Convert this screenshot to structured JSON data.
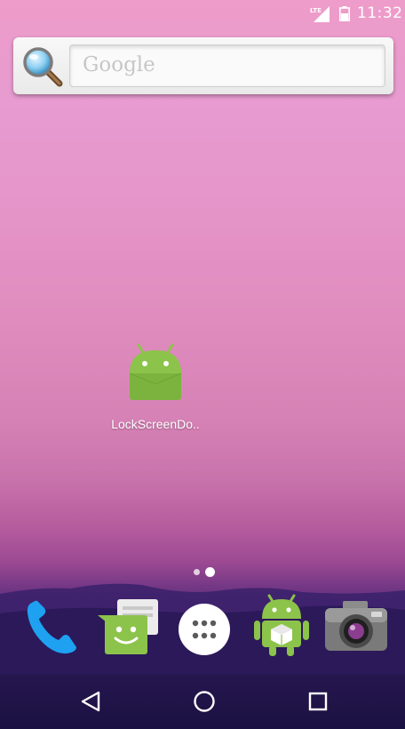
{
  "status_bar": {
    "network_label": "LTE",
    "time": "11:32",
    "icons": [
      "lte-signal-icon",
      "battery-icon"
    ]
  },
  "search_widget": {
    "placeholder": "Google",
    "icon": "magnifier-search-icon"
  },
  "home": {
    "shortcut": {
      "label": "LockScreenDo..",
      "icon": "android-app-icon",
      "icon_color": "#8cc34a"
    },
    "page_indicator": {
      "pages": 2,
      "current_page": 2
    }
  },
  "dock": {
    "items": [
      {
        "name": "phone",
        "icon": "phone-icon",
        "color": "#1ea1f1"
      },
      {
        "name": "messenger",
        "icon": "messenger-icon",
        "color": "#8cc34a"
      },
      {
        "name": "all-apps",
        "icon": "app-drawer-icon",
        "color": "#ffffff"
      },
      {
        "name": "app-store",
        "icon": "android-store-icon",
        "color": "#8cc34a"
      },
      {
        "name": "camera",
        "icon": "camera-icon",
        "color": "#6b6b6b"
      }
    ]
  },
  "nav_bar": {
    "buttons": [
      {
        "name": "back",
        "icon": "back-triangle-icon"
      },
      {
        "name": "home",
        "icon": "home-circle-icon"
      },
      {
        "name": "recents",
        "icon": "recents-square-icon"
      }
    ]
  }
}
